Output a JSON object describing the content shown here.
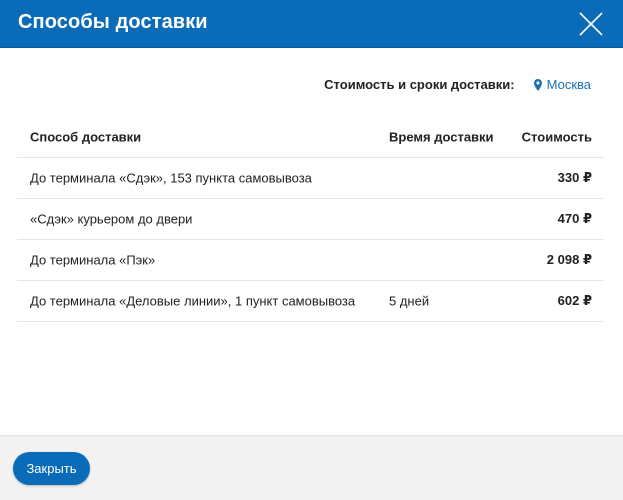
{
  "modal": {
    "title": "Способы доставки",
    "close_icon": "close-icon"
  },
  "location": {
    "label": "Стоимость и сроки доставки:",
    "city": "Москва",
    "icon": "location-pin-icon"
  },
  "table": {
    "headers": {
      "method": "Способ доставки",
      "time": "Время доставки",
      "price": "Стоимость"
    },
    "rows": [
      {
        "method": "До терминала «Сдэк», 153 пункта самовывоза",
        "time": "",
        "price": "330 ₽"
      },
      {
        "method": "«Сдэк» курьером до двери",
        "time": "",
        "price": "470 ₽"
      },
      {
        "method": "До терминала «Пэк»",
        "time": "",
        "price": "2 098 ₽"
      },
      {
        "method": "До терминала «Деловые линии», 1 пункт самовывоза",
        "time": "5 дней",
        "price": "602 ₽"
      }
    ]
  },
  "footer": {
    "close_button": "Закрыть"
  },
  "colors": {
    "primary": "#0a6bb8",
    "link": "#1a6fb5",
    "footer_bg": "#f2f2f2"
  }
}
